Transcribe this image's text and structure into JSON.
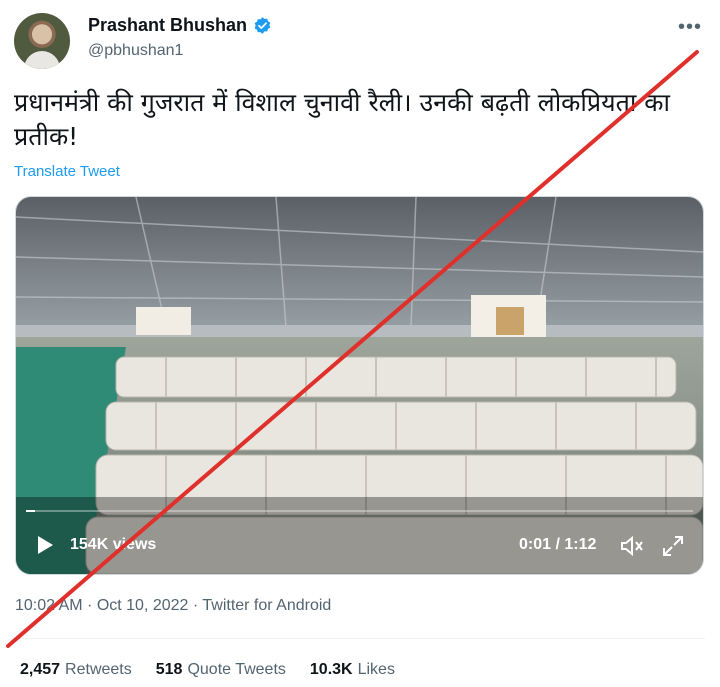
{
  "author": {
    "name": "Prashant Bhushan",
    "handle": "@pbhushan1"
  },
  "tweet": {
    "text": "प्रधानमंत्री की गुजरात में विशाल चुनावी रैली। उनकी बढ़ती लोकप्रियता का प्रतीक!",
    "translate_label": "Translate Tweet"
  },
  "video": {
    "views": "154K views",
    "time": "0:01 / 1:12",
    "progress": 0.014
  },
  "meta": {
    "timestamp": "10:02 AM · Oct 10, 2022 · Twitter for Android"
  },
  "stats": {
    "retweets": {
      "count": "2,457",
      "label": "Retweets"
    },
    "quotes": {
      "count": "518",
      "label": "Quote Tweets"
    },
    "likes": {
      "count": "10.3K",
      "label": "Likes"
    }
  },
  "colors": {
    "accent": "#1d9bf0",
    "strike": "#e0302c",
    "secondary_text": "#536471"
  },
  "icons": [
    "verified-badge-icon",
    "more-options-icon",
    "play-icon",
    "volume-icon",
    "expand-icon"
  ]
}
